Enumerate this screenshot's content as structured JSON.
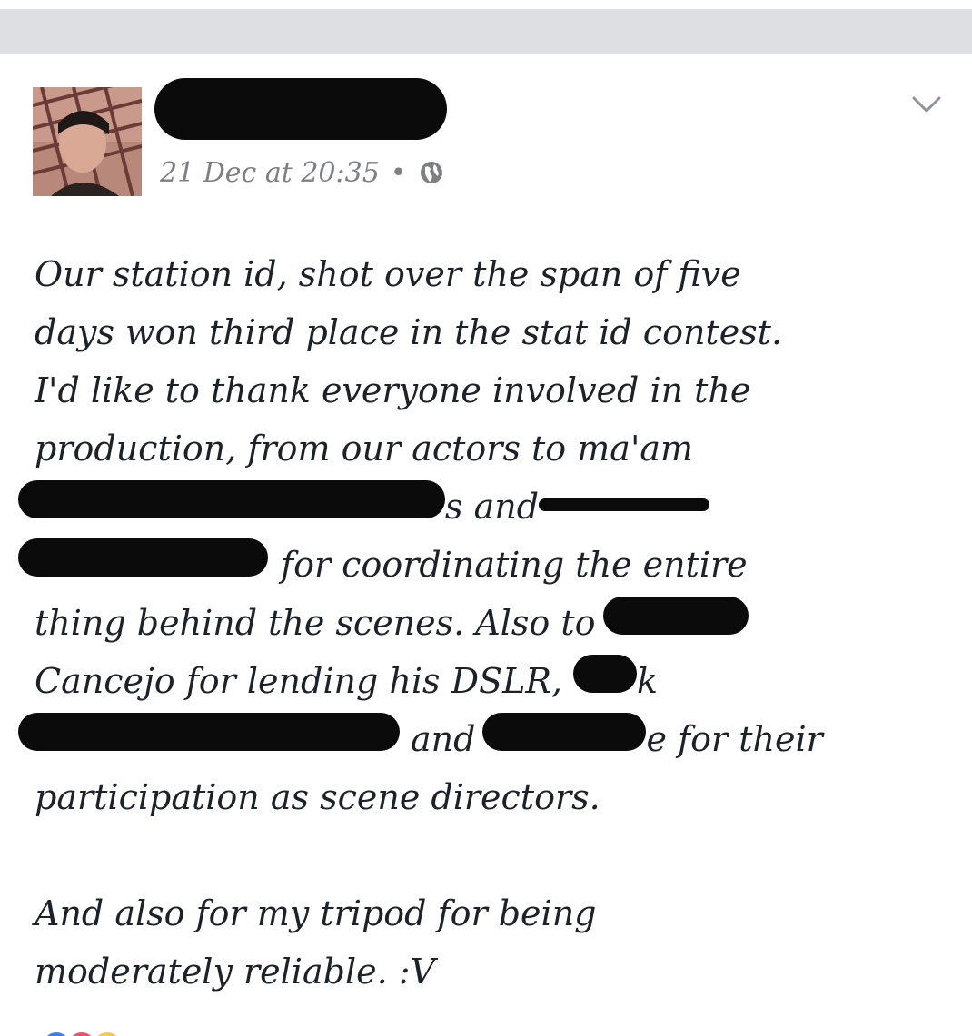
{
  "post": {
    "timestamp": "21 Dec at 20:35",
    "separator": "•",
    "privacy_icon": "globe-icon",
    "menu_icon": "chevron-down-icon",
    "lines": [
      {
        "parts": [
          "Our station id, shot over the span of five"
        ]
      },
      {
        "parts": [
          "days won third place in the stat id contest."
        ]
      },
      {
        "parts": [
          "I'd like to thank everyone involved in the"
        ]
      },
      {
        "parts": [
          "production, from our actors to ma'am"
        ]
      },
      {
        "parts": [
          "",
          "s and",
          ""
        ]
      },
      {
        "parts": [
          "",
          "for coordinating the entire"
        ]
      },
      {
        "parts": [
          "thing behind the scenes. Also to",
          ""
        ]
      },
      {
        "parts": [
          "Cancejo for lending his DSLR,",
          "k"
        ]
      },
      {
        "parts": [
          "",
          "and",
          "e for their"
        ]
      },
      {
        "parts": [
          "participation as scene directors."
        ]
      },
      {
        "parts": [
          ""
        ]
      },
      {
        "parts": [
          "And also for my tripod for being"
        ]
      },
      {
        "parts": [
          "moderately reliable. :V"
        ]
      }
    ]
  },
  "colors": {
    "band": "#dddfe2",
    "meta_text": "#7d7f85",
    "body_text": "#1d2129",
    "redaction": "#0b0b0b"
  }
}
